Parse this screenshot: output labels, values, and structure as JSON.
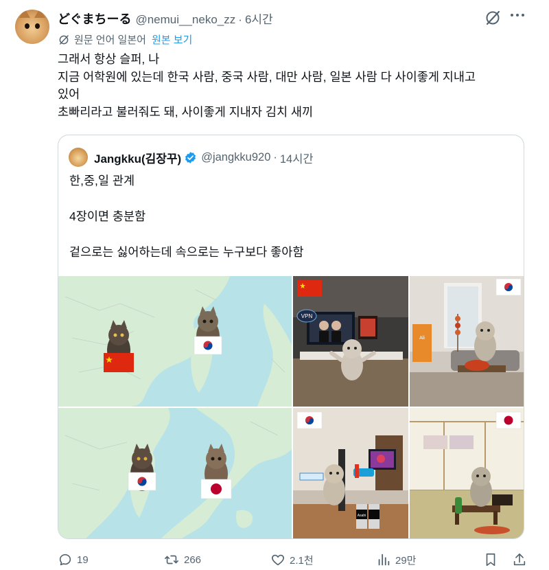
{
  "post": {
    "display_name": "どぐまちーる",
    "handle": "@nemui__neko_zz",
    "separator": "·",
    "time": "6시간",
    "translate_label": "원문 언어 일본어",
    "view_original": "원본 보기",
    "text_lines": [
      "그래서 항상 슬퍼, 나",
      "지금 어학원에 있는데 한국 사람, 중국 사람, 대만 사람, 일본 사람 다 사이좋게 지내고",
      "있어",
      "초빠리라고 불러줘도 돼, 사이좋게 지내자 김치 새끼"
    ]
  },
  "quote": {
    "display_name": "Jangkku(김장꾸)",
    "handle": "@jangkku920",
    "separator": "·",
    "time": "14시간",
    "text_lines": [
      "한,중,일 관계",
      "4장이면 충분함",
      "겉으로는 싫어하는데 속으로는 누구보다 좋아함"
    ],
    "image_text": {
      "vpn_label": "VPN",
      "beer_label": "Asahi",
      "box_label": "Ali"
    }
  },
  "actions": {
    "replies": "19",
    "reposts": "266",
    "likes": "2.1천",
    "views": "29만"
  },
  "colors": {
    "accent": "#1d9bf0",
    "secondary_text": "#536471",
    "border": "#cfd9de",
    "map_sea": "#b7e3e8",
    "map_land": "#d6ecd4"
  },
  "icons": [
    "grok-icon",
    "more-icon",
    "translate-icon",
    "verified-icon",
    "reply-icon",
    "repost-icon",
    "like-icon",
    "views-icon",
    "bookmark-icon",
    "share-icon"
  ]
}
